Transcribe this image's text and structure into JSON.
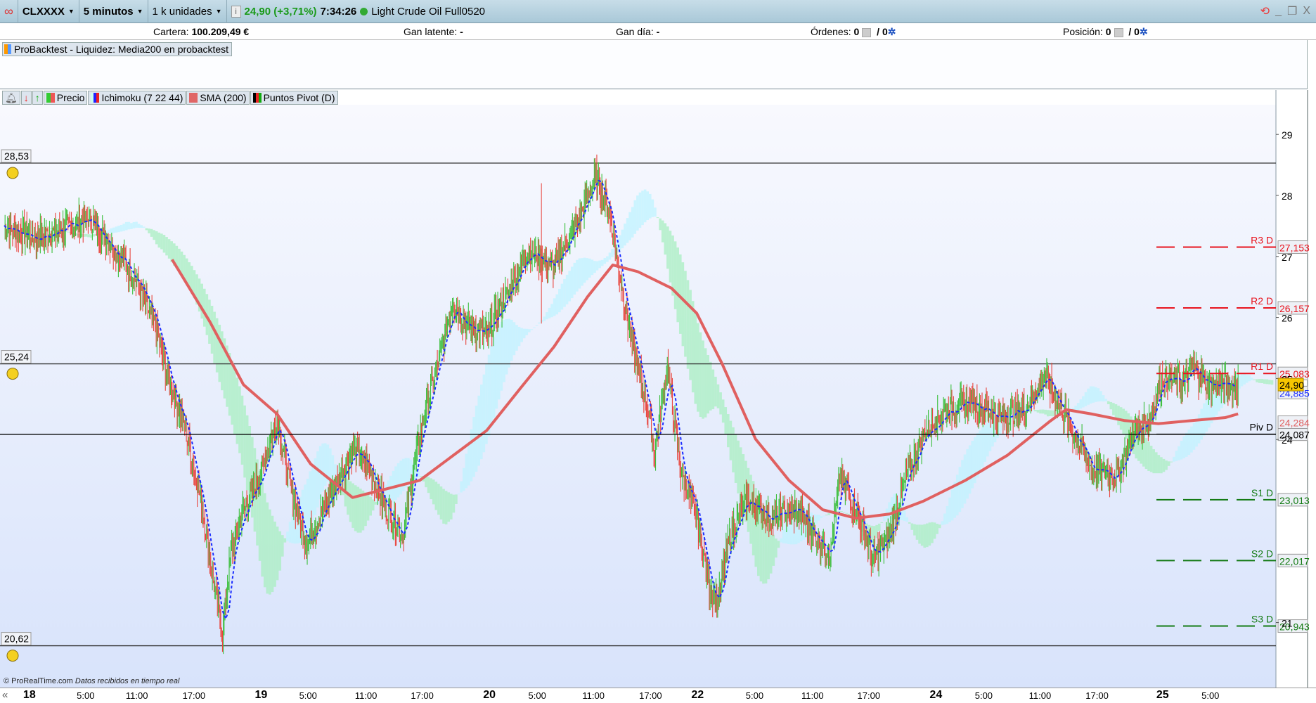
{
  "topbar": {
    "symbol": "CLXXXX",
    "interval": "5 minutos",
    "units": "1 k unidades",
    "price_change": "24,90 (+3,71%)",
    "time": "7:34:26",
    "instrument": "Light Crude Oil Full0520",
    "price_color": "#1a9a1a"
  },
  "infobar": {
    "cartera_label": "Cartera:",
    "cartera_value": "100.209,49 €",
    "gan_latente_label": "Gan latente:",
    "gan_latente_value": "-",
    "gan_dia_label": "Gan día:",
    "gan_dia_value": "-",
    "ordenes_label": "Órdenes:",
    "ordenes_value": "0",
    "ordenes_total": "/ 0",
    "posicion_label": "Posición:",
    "posicion_value": "0",
    "posicion_total": "/ 0"
  },
  "probacktest": {
    "label": "ProBacktest - Liquidez: Media200 en probacktest"
  },
  "legend": [
    {
      "label": "Precio"
    },
    {
      "label": "Ichimoku (7 22 44)"
    },
    {
      "label": "SMA (200)"
    },
    {
      "label": "Puntos Pivot (D)"
    }
  ],
  "footer": {
    "brand": "© ProRealTime.com",
    "note": "Datos recibidos en tiempo real"
  },
  "timeaxis": {
    "back": "«",
    "labels": [
      {
        "t": "18",
        "day": true,
        "bar": 30
      },
      {
        "t": "5:00",
        "bar": 97
      },
      {
        "t": "11:00",
        "bar": 158
      },
      {
        "t": "17:00",
        "bar": 226
      },
      {
        "t": "19",
        "day": true,
        "bar": 306
      },
      {
        "t": "5:00",
        "bar": 362
      },
      {
        "t": "11:00",
        "bar": 431
      },
      {
        "t": "17:00",
        "bar": 498
      },
      {
        "t": "20",
        "day": true,
        "bar": 578
      },
      {
        "t": "5:00",
        "bar": 635
      },
      {
        "t": "11:00",
        "bar": 702
      },
      {
        "t": "17:00",
        "bar": 770
      },
      {
        "t": "22",
        "day": true,
        "bar": 826
      },
      {
        "t": "5:00",
        "bar": 894
      },
      {
        "t": "11:00",
        "bar": 963
      },
      {
        "t": "17:00",
        "bar": 1030
      },
      {
        "t": "24",
        "day": true,
        "bar": 1110
      },
      {
        "t": "5:00",
        "bar": 1167
      },
      {
        "t": "11:00",
        "bar": 1234
      },
      {
        "t": "17:00",
        "bar": 1302
      },
      {
        "t": "25",
        "day": true,
        "bar": 1380
      },
      {
        "t": "5:00",
        "bar": 1437
      }
    ]
  },
  "chart_data": {
    "type": "line",
    "ylim": [
      20.2,
      29.4
    ],
    "yticks": [
      "29",
      "28",
      "27",
      "26",
      "25",
      "24",
      "21"
    ],
    "ytick_values": [
      29,
      28,
      27,
      26,
      25,
      24,
      21
    ],
    "alert_lines": [
      {
        "label": "28,53",
        "value": 28.53
      },
      {
        "label": "25,24",
        "value": 25.24
      },
      {
        "label": "20,62",
        "value": 20.62
      }
    ],
    "pivots": [
      {
        "name": "R3 D",
        "value": 27.153,
        "label": "27,153",
        "color": "#e8141e"
      },
      {
        "name": "R2 D",
        "value": 26.157,
        "label": "26,157",
        "color": "#e8141e"
      },
      {
        "name": "R1 D",
        "value": 25.083,
        "label": "25,083",
        "color": "#e8141e"
      },
      {
        "name": "Piv D",
        "value": 24.087,
        "label": "24,087",
        "color": "#000000"
      },
      {
        "name": "S1 D",
        "value": 23.013,
        "label": "23,013",
        "color": "#137a13"
      },
      {
        "name": "S2 D",
        "value": 22.017,
        "label": "22,017",
        "color": "#137a13"
      },
      {
        "name": "S3 D",
        "value": 20.943,
        "label": "20,943",
        "color": "#137a13"
      }
    ],
    "last_price": {
      "value": 24.9,
      "label": "24,90"
    },
    "tenkan_last": {
      "value": 24.885,
      "label": "24,885"
    },
    "sma_last": {
      "value": 24.284,
      "label": "24,284"
    },
    "price": {
      "bars": [
        0,
        35,
        55,
        100,
        125,
        155,
        180,
        195,
        215,
        235,
        250,
        260,
        270,
        285,
        305,
        325,
        340,
        360,
        375,
        395,
        415,
        435,
        455,
        475,
        495,
        515,
        535,
        550,
        575,
        595,
        625,
        655,
        685,
        705,
        720,
        735,
        750,
        765,
        775,
        790,
        805,
        825,
        840,
        850,
        865,
        885,
        915,
        945,
        965,
        985,
        995,
        1015,
        1035,
        1055,
        1075,
        1095,
        1125,
        1155,
        1185,
        1215,
        1240,
        1255,
        1275,
        1295,
        1325,
        1345,
        1365,
        1380,
        1405,
        1415,
        1435,
        1470
      ],
      "values": [
        27.51,
        27.3,
        27.37,
        27.62,
        27.23,
        26.68,
        25.85,
        25.03,
        24.21,
        22.97,
        21.6,
        20.78,
        22.15,
        22.84,
        23.4,
        24.36,
        23.26,
        22.3,
        22.71,
        23.26,
        23.81,
        23.53,
        22.85,
        22.44,
        24.08,
        25.18,
        26.27,
        25.86,
        25.73,
        26.27,
        27.1,
        26.82,
        27.64,
        28.32,
        27.77,
        26.53,
        25.44,
        24.62,
        23.81,
        25.18,
        23.53,
        22.71,
        21.6,
        21.33,
        22.44,
        22.99,
        22.71,
        22.85,
        22.44,
        22.16,
        23.4,
        22.85,
        22.03,
        22.44,
        23.4,
        24.08,
        24.49,
        24.62,
        24.36,
        24.49,
        25.04,
        24.62,
        24.08,
        23.53,
        23.4,
        24.08,
        24.36,
        25.04,
        24.9,
        25.18,
        24.9,
        24.9
      ]
    },
    "sma": {
      "bars": [
        200,
        245,
        285,
        325,
        365,
        415,
        455,
        495,
        535,
        575,
        615,
        655,
        695,
        725,
        755,
        795,
        825,
        855,
        895,
        935,
        975,
        1015,
        1055,
        1095,
        1145,
        1195,
        1245,
        1265,
        1295,
        1335,
        1375,
        1415,
        1455,
        1470
      ],
      "values": [
        26.95,
        25.93,
        24.9,
        24.42,
        23.6,
        23.05,
        23.19,
        23.33,
        23.74,
        24.15,
        24.84,
        25.52,
        26.34,
        26.86,
        26.75,
        26.48,
        26.07,
        25.25,
        24.01,
        23.33,
        22.85,
        22.71,
        22.78,
        22.99,
        23.33,
        23.74,
        24.29,
        24.49,
        24.42,
        24.31,
        24.26,
        24.31,
        24.36,
        24.42
      ]
    }
  }
}
